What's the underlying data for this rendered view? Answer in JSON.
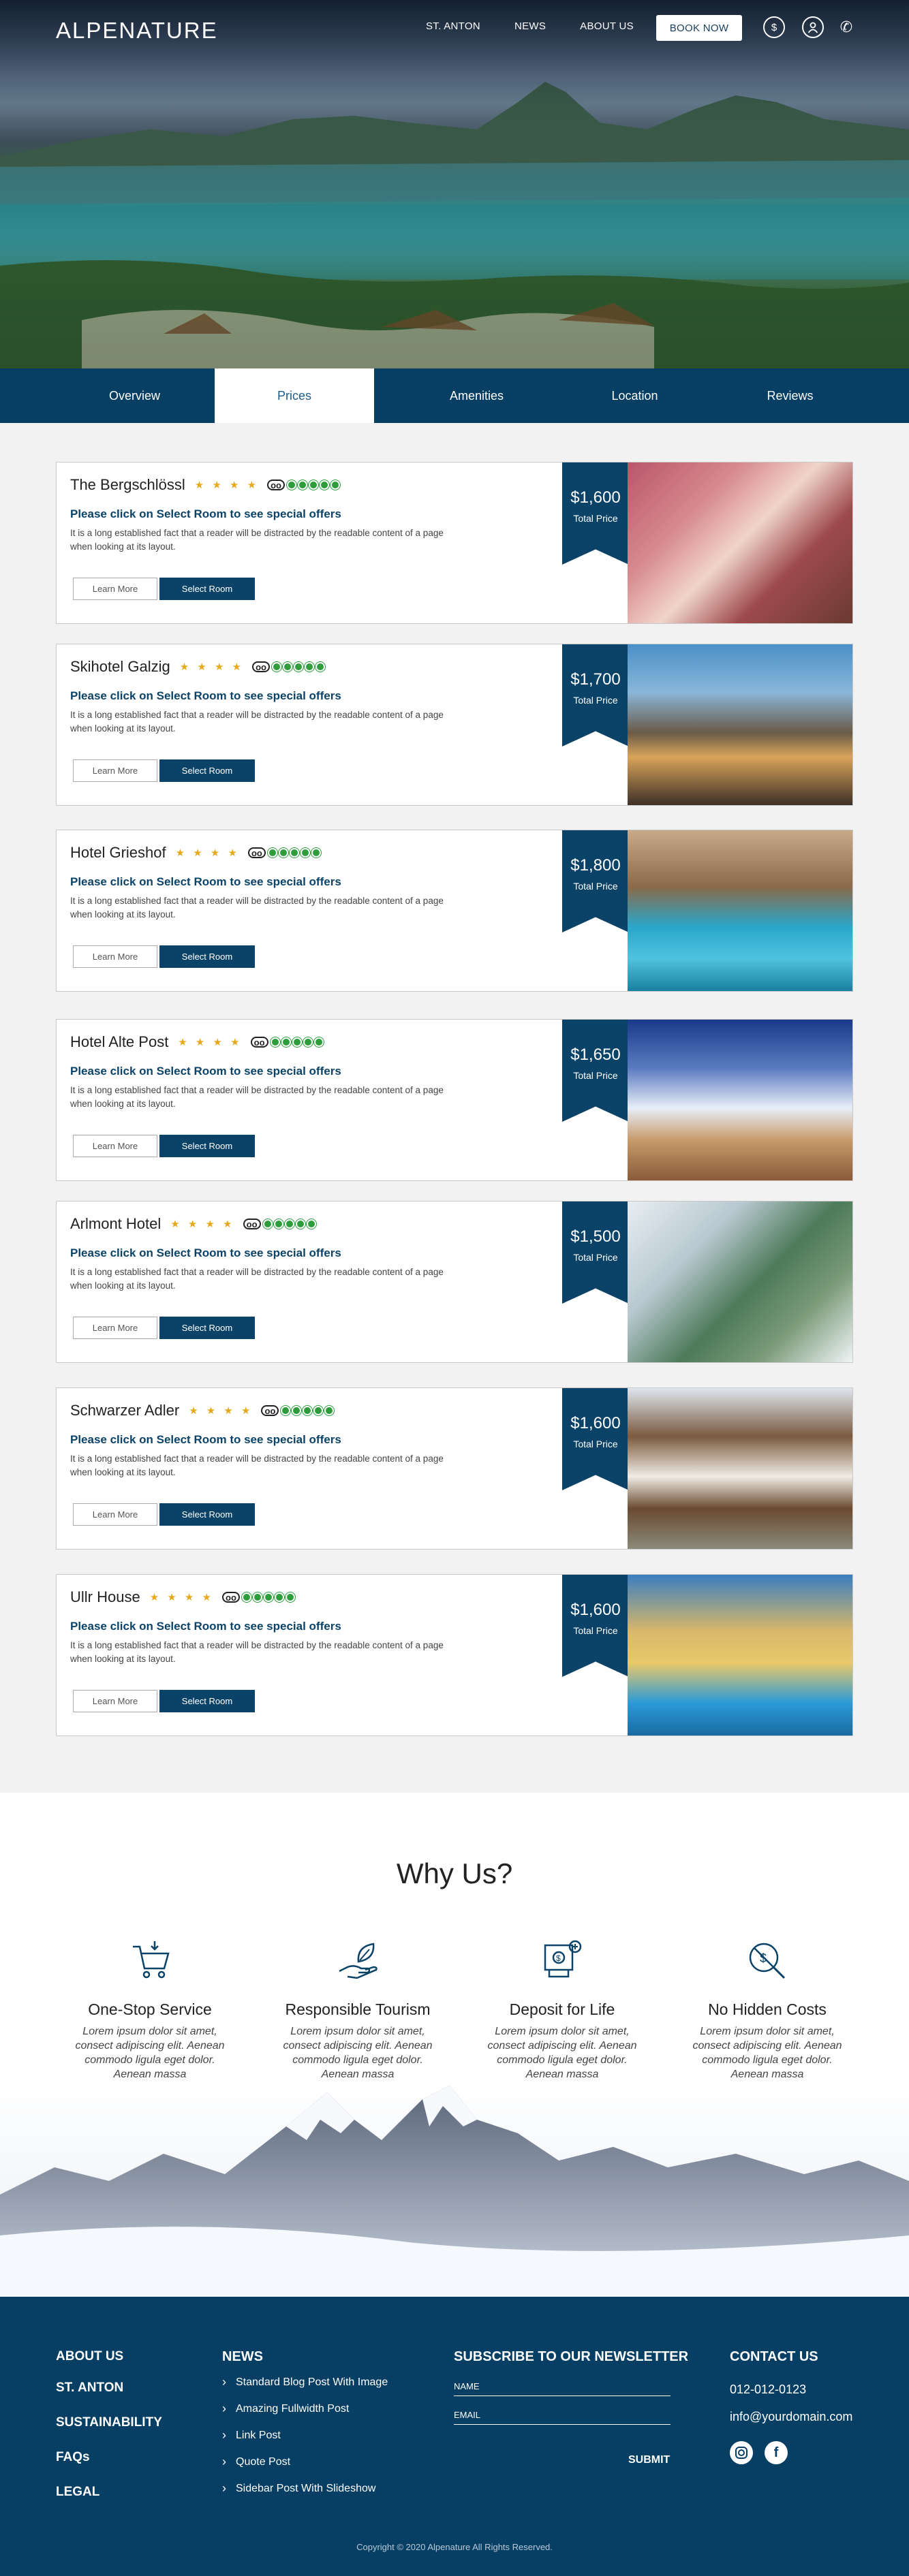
{
  "brand": {
    "logo": "ALPENATURE"
  },
  "nav": {
    "items": [
      "ST. ANTON",
      "NEWS",
      "ABOUT US"
    ],
    "book": "BOOK NOW"
  },
  "header_icons": [
    "currency-icon",
    "user-icon",
    "phone-icon"
  ],
  "tabs": [
    "Overview",
    "Prices",
    "Amenities",
    "Location",
    "Reviews"
  ],
  "active_tab": "Prices",
  "hotel_common": {
    "offer": "Please click on Select Room to see special offers",
    "desc": "It is a long established fact that a reader will be distracted by the readable content of a page when looking at its layout.",
    "learn": "Learn More",
    "select": "Select Room",
    "price_label": "Total Price"
  },
  "hotels": [
    {
      "name": "The Bergschlössl",
      "stars": "★ ★ ★ ★",
      "price": "$1,600"
    },
    {
      "name": "Skihotel Galzig",
      "stars": "★ ★ ★ ★",
      "price": "$1,700"
    },
    {
      "name": "Hotel Grieshof",
      "stars": "★ ★ ★ ★",
      "price": "$1,800"
    },
    {
      "name": "Hotel Alte Post",
      "stars": "★ ★ ★ ★",
      "price": "$1,650"
    },
    {
      "name": "Arlmont Hotel",
      "stars": "★ ★ ★ ★",
      "price": "$1,500"
    },
    {
      "name": "Schwarzer Adler",
      "stars": "★ ★ ★ ★",
      "price": "$1,600"
    },
    {
      "name": "Ullr House",
      "stars": "★ ★ ★ ★",
      "price": "$1,600"
    }
  ],
  "why": {
    "title": "Why Us?",
    "features": [
      {
        "title": "One-Stop Service",
        "desc": "Lorem ipsum dolor sit amet, consect adipiscing elit. Aenean commodo ligula eget dolor. Aenean massa"
      },
      {
        "title": "Responsible Tourism",
        "desc": "Lorem ipsum dolor sit amet, consect adipiscing elit. Aenean commodo ligula eget dolor. Aenean massa"
      },
      {
        "title": "Deposit for Life",
        "desc": "Lorem ipsum dolor sit amet, consect adipiscing elit. Aenean commodo ligula eget dolor. Aenean massa"
      },
      {
        "title": "No Hidden Costs",
        "desc": "Lorem ipsum dolor sit amet, consect adipiscing elit. Aenean commodo ligula eget dolor. Aenean massa"
      }
    ]
  },
  "footer": {
    "links": [
      "ABOUT US",
      "ST. ANTON",
      "SUSTAINABILITY",
      "FAQs",
      "LEGAL"
    ],
    "news_title": "NEWS",
    "news": [
      "Standard Blog Post With Image",
      "Amazing Fullwidth Post",
      "Link Post",
      "Quote Post",
      "Sidebar Post With Slideshow"
    ],
    "newsletter_title": "SUBSCRIBE TO OUR NEWSLETTER",
    "name_label": "NAME",
    "email_label": "EMAIL",
    "submit": "SUBMIT",
    "contact_title": "CONTACT US",
    "phone": "012-012-0123",
    "email": "info@yourdomain.com",
    "copyright": "Copyright © 2020  Alpenature  All Rights Reserved."
  }
}
